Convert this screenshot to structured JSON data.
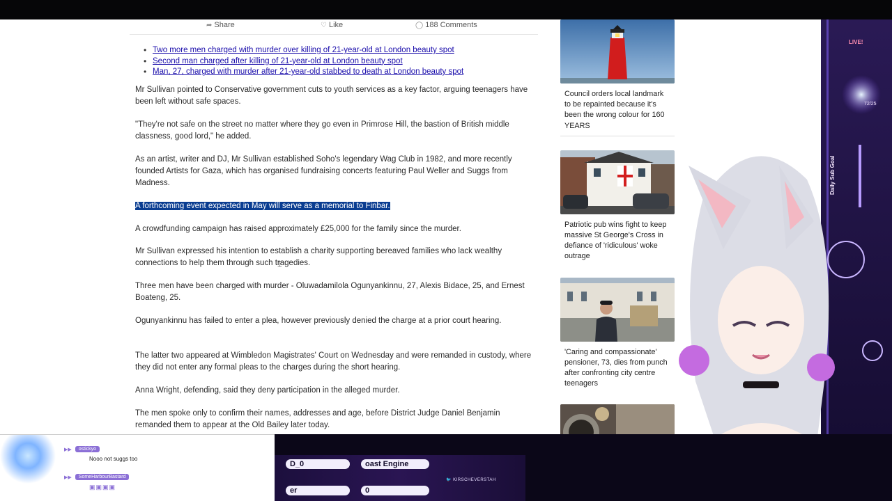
{
  "share_bar": {
    "share_label": "Share",
    "like_label": "Like",
    "comments_label": "188 Comments"
  },
  "related_links": [
    "Two more men charged with murder over killing of 21-year-old at London beauty spot",
    "Second man charged after killing of 21-year-old at London beauty spot",
    "Man, 27, charged with murder after 21-year-old stabbed to death at London beauty spot"
  ],
  "paragraphs": [
    "Mr Sullivan pointed to Conservative government cuts to youth services as a key factor, arguing teenagers have been left without safe spaces.",
    "\"They're not safe on the street no matter where they go even in Primrose Hill, the bastion of British middle classness, good lord,\" he added.",
    "As an artist, writer and DJ, Mr Sullivan established Soho's legendary Wag Club in 1982, and more recently founded Artists for Gaza, which has organised fundraising concerts featuring Paul Weller and Suggs from Madness.",
    "A forthcoming event expected in May will serve as a memorial to Finbar.",
    "A crowdfunding campaign has raised approximately £25,000 for the family since the murder.",
    "Mr Sullivan expressed his intention to establish a charity supporting bereaved families who lack wealthy connections to help them through such tragedies.",
    "Three men have been charged with murder - Oluwadamilola Ogunyankinnu, 27, Alexis Bidace, 25, and Ernest Boateng, 25.",
    "Ogunyankinnu has failed to enter a plea, however previously denied the charge at a prior court hearing.",
    "The latter two appeared at Wimbledon Magistrates' Court on Wednesday and were remanded in custody, where they did not enter any formal pleas to the charges during the short hearing.",
    "Anna Wright, defending, said they deny participation in the alleged murder.",
    "The men spoke only to confirm their names, addresses and age, before District Judge Daniel Benjamin remanded them to appear at the Old Bailey later today."
  ],
  "sidebar": [
    {
      "title": "Council orders local landmark to be repainted because it's been the wrong colour for 160 YEARS"
    },
    {
      "title": "Patriotic pub wins fight to keep massive St George's Cross in defiance of 'ridiculous' woke outrage"
    },
    {
      "title": "'Caring and compassionate' pensioner, 73, dies from punch after confronting city centre teenagers"
    }
  ],
  "overlay": {
    "live_label": "LIVE!",
    "sub_goal_label": "Daily Sub Goal",
    "sub_goal_count": "72/25"
  },
  "chat": [
    {
      "user": "ostickyo",
      "message": ""
    },
    {
      "user": "",
      "message": "Nooo not suggs too"
    },
    {
      "user": "SomeHarbourBastard",
      "message": ""
    }
  ],
  "stream_bar": {
    "field1": "D_0",
    "field2": "oast Engine",
    "field3": "er",
    "field4": "0",
    "social_handle": "KIRSCHEVERSTAH"
  },
  "colors": {
    "highlight": "#0a3d91",
    "link": "#1a0dab",
    "overlay_purple": "#6a3fd0"
  }
}
